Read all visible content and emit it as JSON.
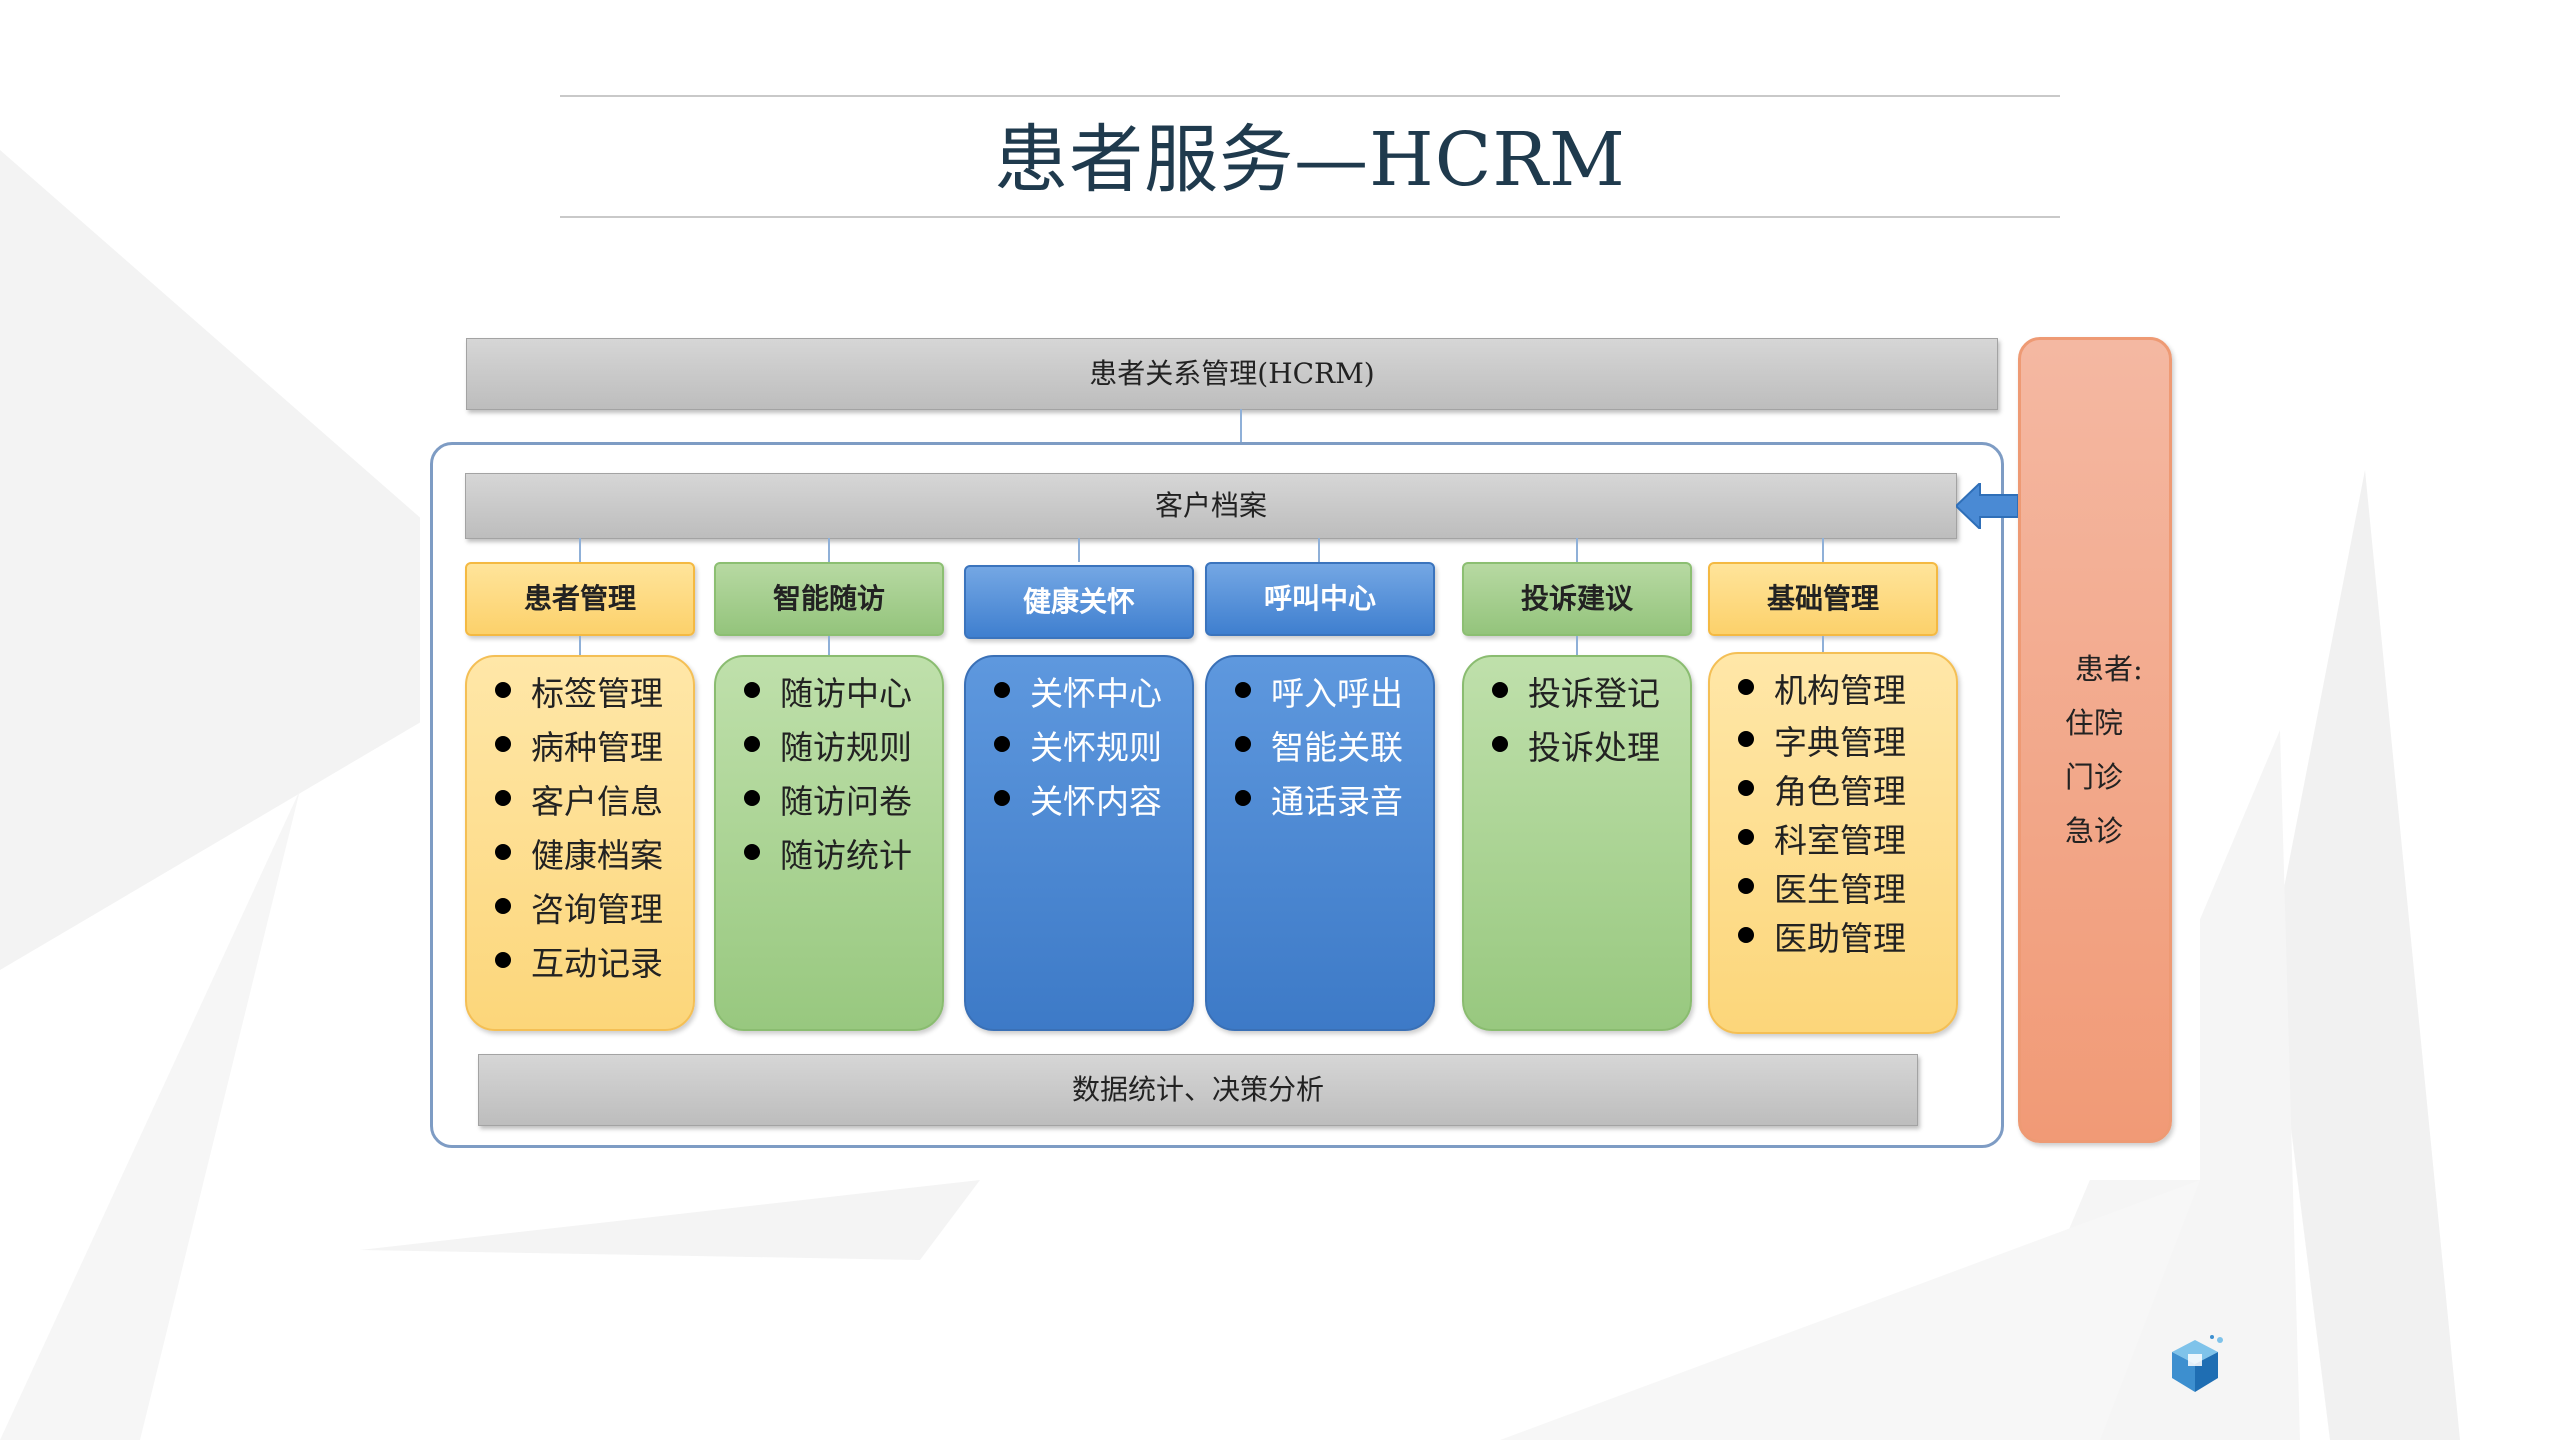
{
  "title": "患者服务—HCRM",
  "diagram": {
    "top_bar": "患者关系管理(HCRM)",
    "archive_bar": "客户档案",
    "bottom_bar": "数据统计、决策分析",
    "columns": [
      {
        "header": "患者管理",
        "color": "yellow",
        "items": [
          "标签管理",
          "病种管理",
          "客户信息",
          "健康档案",
          "咨询管理",
          "互动记录"
        ]
      },
      {
        "header": "智能随访",
        "color": "green",
        "items": [
          "随访中心",
          "随访规则",
          "随访问卷",
          "随访统计"
        ]
      },
      {
        "header": "健康关怀",
        "color": "blue",
        "items": [
          "关怀中心",
          "关怀规则",
          "关怀内容"
        ]
      },
      {
        "header": "呼叫中心",
        "color": "blue",
        "items": [
          "呼入呼出",
          "智能关联",
          "通话录音"
        ]
      },
      {
        "header": "投诉建议",
        "color": "green",
        "items": [
          "投诉登记",
          "投诉处理"
        ]
      },
      {
        "header": "基础管理",
        "color": "yellow",
        "items": [
          "机构管理",
          "字典管理",
          "角色管理",
          "科室管理",
          "医生管理",
          "医助管理"
        ]
      }
    ],
    "side_panel": {
      "heading": "患者:",
      "items": [
        "住院",
        "门诊",
        "急诊"
      ]
    }
  },
  "colors": {
    "title": "#1f3a4d",
    "yellow": "#fcd16b",
    "green": "#94c47c",
    "blue": "#3f7fcf",
    "side": "#f19a76",
    "frame": "#7e9cc4",
    "arrow": "#4a8ad4"
  },
  "icons": {
    "arrow": "left-arrow-icon",
    "logo": "cube-logo-icon"
  }
}
